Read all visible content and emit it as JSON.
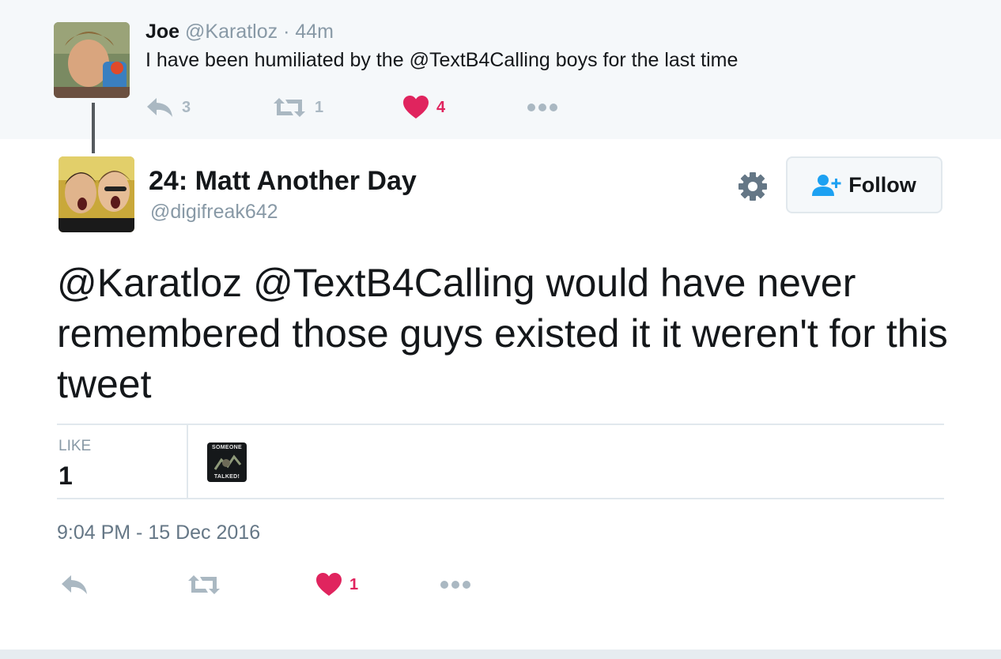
{
  "parent_tweet": {
    "name": "Joe",
    "handle": "@Karatloz",
    "separator": "·",
    "time": "44m",
    "text_before": "I have been humiliated by the ",
    "mention": "@TextB4Calling",
    "text_after": " boys for the last time",
    "reply_count": "3",
    "retweet_count": "1",
    "like_count": "4"
  },
  "main_tweet": {
    "name": "24: Matt Another Day",
    "handle": "@digifreak642",
    "follow_label": "Follow",
    "mention_1": "@Karatloz",
    "mention_2": "@TextB4Calling",
    "text_rest": " would have never remembered those guys existed it it weren't for this tweet",
    "like_label": "LIKE",
    "like_total": "1",
    "liker_avatar_top": "SOMEONE",
    "liker_avatar_bottom": "TALKED!",
    "timestamp": "9:04 PM - 15 Dec 2016",
    "like_count": "1"
  },
  "colors": {
    "parent_bg": "#f5f8fa",
    "like_red": "#e0245e",
    "icon_grey": "#aab8c2",
    "follow_blue": "#1da1f2",
    "muted_text": "#8899a6"
  },
  "icons": [
    "reply-icon",
    "retweet-icon",
    "heart-icon",
    "more-icon",
    "gear-icon",
    "follow-person-icon"
  ]
}
